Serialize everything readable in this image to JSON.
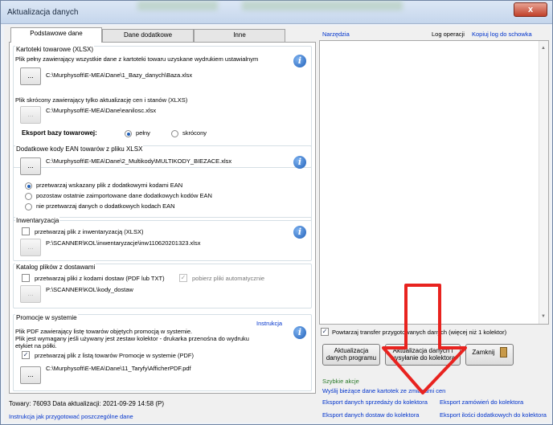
{
  "window": {
    "title": "Aktualizacja danych",
    "close_label": "x"
  },
  "tabs": [
    {
      "label": "Podstawowe dane"
    },
    {
      "label": "Dane dodatkowe"
    },
    {
      "label": "Inne"
    }
  ],
  "kartoteki": {
    "title": "Kartoteki towarowe (XLSX)",
    "full_desc": "Plik pełny zawierający wszystkie dane z kartoteki towaru uzyskane wydrukiem ustawialnym",
    "full_path": "C:\\Murphysoft\\E-MEA\\Dane\\1_Bazy_danych\\Baza.xlsx",
    "short_desc": "Plik skrócony zawierający tylko aktualizację cen i stanów (XLXS)",
    "short_path": "C:\\Murphysoft\\E-MEA\\Dane\\eanilosc.xlsx",
    "export_label": "Eksport bazy towarowej:",
    "opt_full": "pełny",
    "opt_short": "skrócony",
    "browse": "..."
  },
  "ean": {
    "title": "Dodatkowe kody EAN towarów z pliku XLSX",
    "path": "C:\\Murphysoft\\E-MEA\\Dane\\2_Multikody\\MULTIKODY_BIEZACE.xlsx",
    "opt1": "przetwarzaj wskazany plik z dodatkowymi kodami EAN",
    "opt2": "pozostaw ostatnie zaimportowane dane dodatkowych kodów EAN",
    "opt3": "nie przetwarzaj danych o dodatkowych kodach EAN"
  },
  "inwent": {
    "title": "Inwentaryzacja",
    "check": "przetwarzaj plik z inwentaryzacją (XLSX)",
    "path": "P:\\SCANNER\\KOL\\inwentaryzacje\\inw110620201323.xlsx"
  },
  "katalog": {
    "title": "Katalog plików z dostawami",
    "check1": "przetwarzaj pliki z kodami dostaw (PDF lub TXT)",
    "check2": "pobierz pliki automatycznie",
    "path": "P:\\SCANNER\\KOL\\kody_dostaw"
  },
  "promocje": {
    "title": "Promocje w systemie",
    "instr": "Instrukcja",
    "desc1": "Plik PDF zawierający listę towarów objętych promocją w systemie.",
    "desc2": "Plik jest wymagany jeśli używany jest zestaw kolektor - drukarka przenośna do wydruku",
    "desc3": "etykiet na półki.",
    "check": "przetwarzaj plik z listą towarów Promocje w systemie (PDF)",
    "path": "C:\\Murphysoft\\E-MEA\\Dane\\11_Taryfy\\AfficherPDF.pdf"
  },
  "status": {
    "line": "Towary: 76093  Data aktualizacji: 2021-09-29 14:58 (P)",
    "link": "Instrukcja jak przygotować poszczególne dane"
  },
  "right": {
    "narzedzia": "Narzędzia",
    "log": "Log operacji",
    "copy_log": "Kopiuj log do schowka",
    "repeat_check": "Powtarzaj transfer przygotowanych danych (więcej niż 1 kolektor)",
    "btn_update": "Aktualizacja danych programu",
    "btn_send": "Aktualizacja danych  i wysyłanie do kolektora",
    "btn_close": "Zamknij",
    "quick_title": "Szybkie akcje",
    "quick1": "Wyślij bieżące dane kartotek ze zmianami cen",
    "quick2": "Eksport danych sprzedaży do kolektora",
    "quick3": "Eksport zamówień do kolektora",
    "quick4": "Eksport danych dostaw do kolektora",
    "quick5": "Eksport ilości dodatkowych do kolektora"
  },
  "colors": {
    "link": "#0033cc",
    "arrow": "#e8231f",
    "info": "#1f5fb8"
  }
}
